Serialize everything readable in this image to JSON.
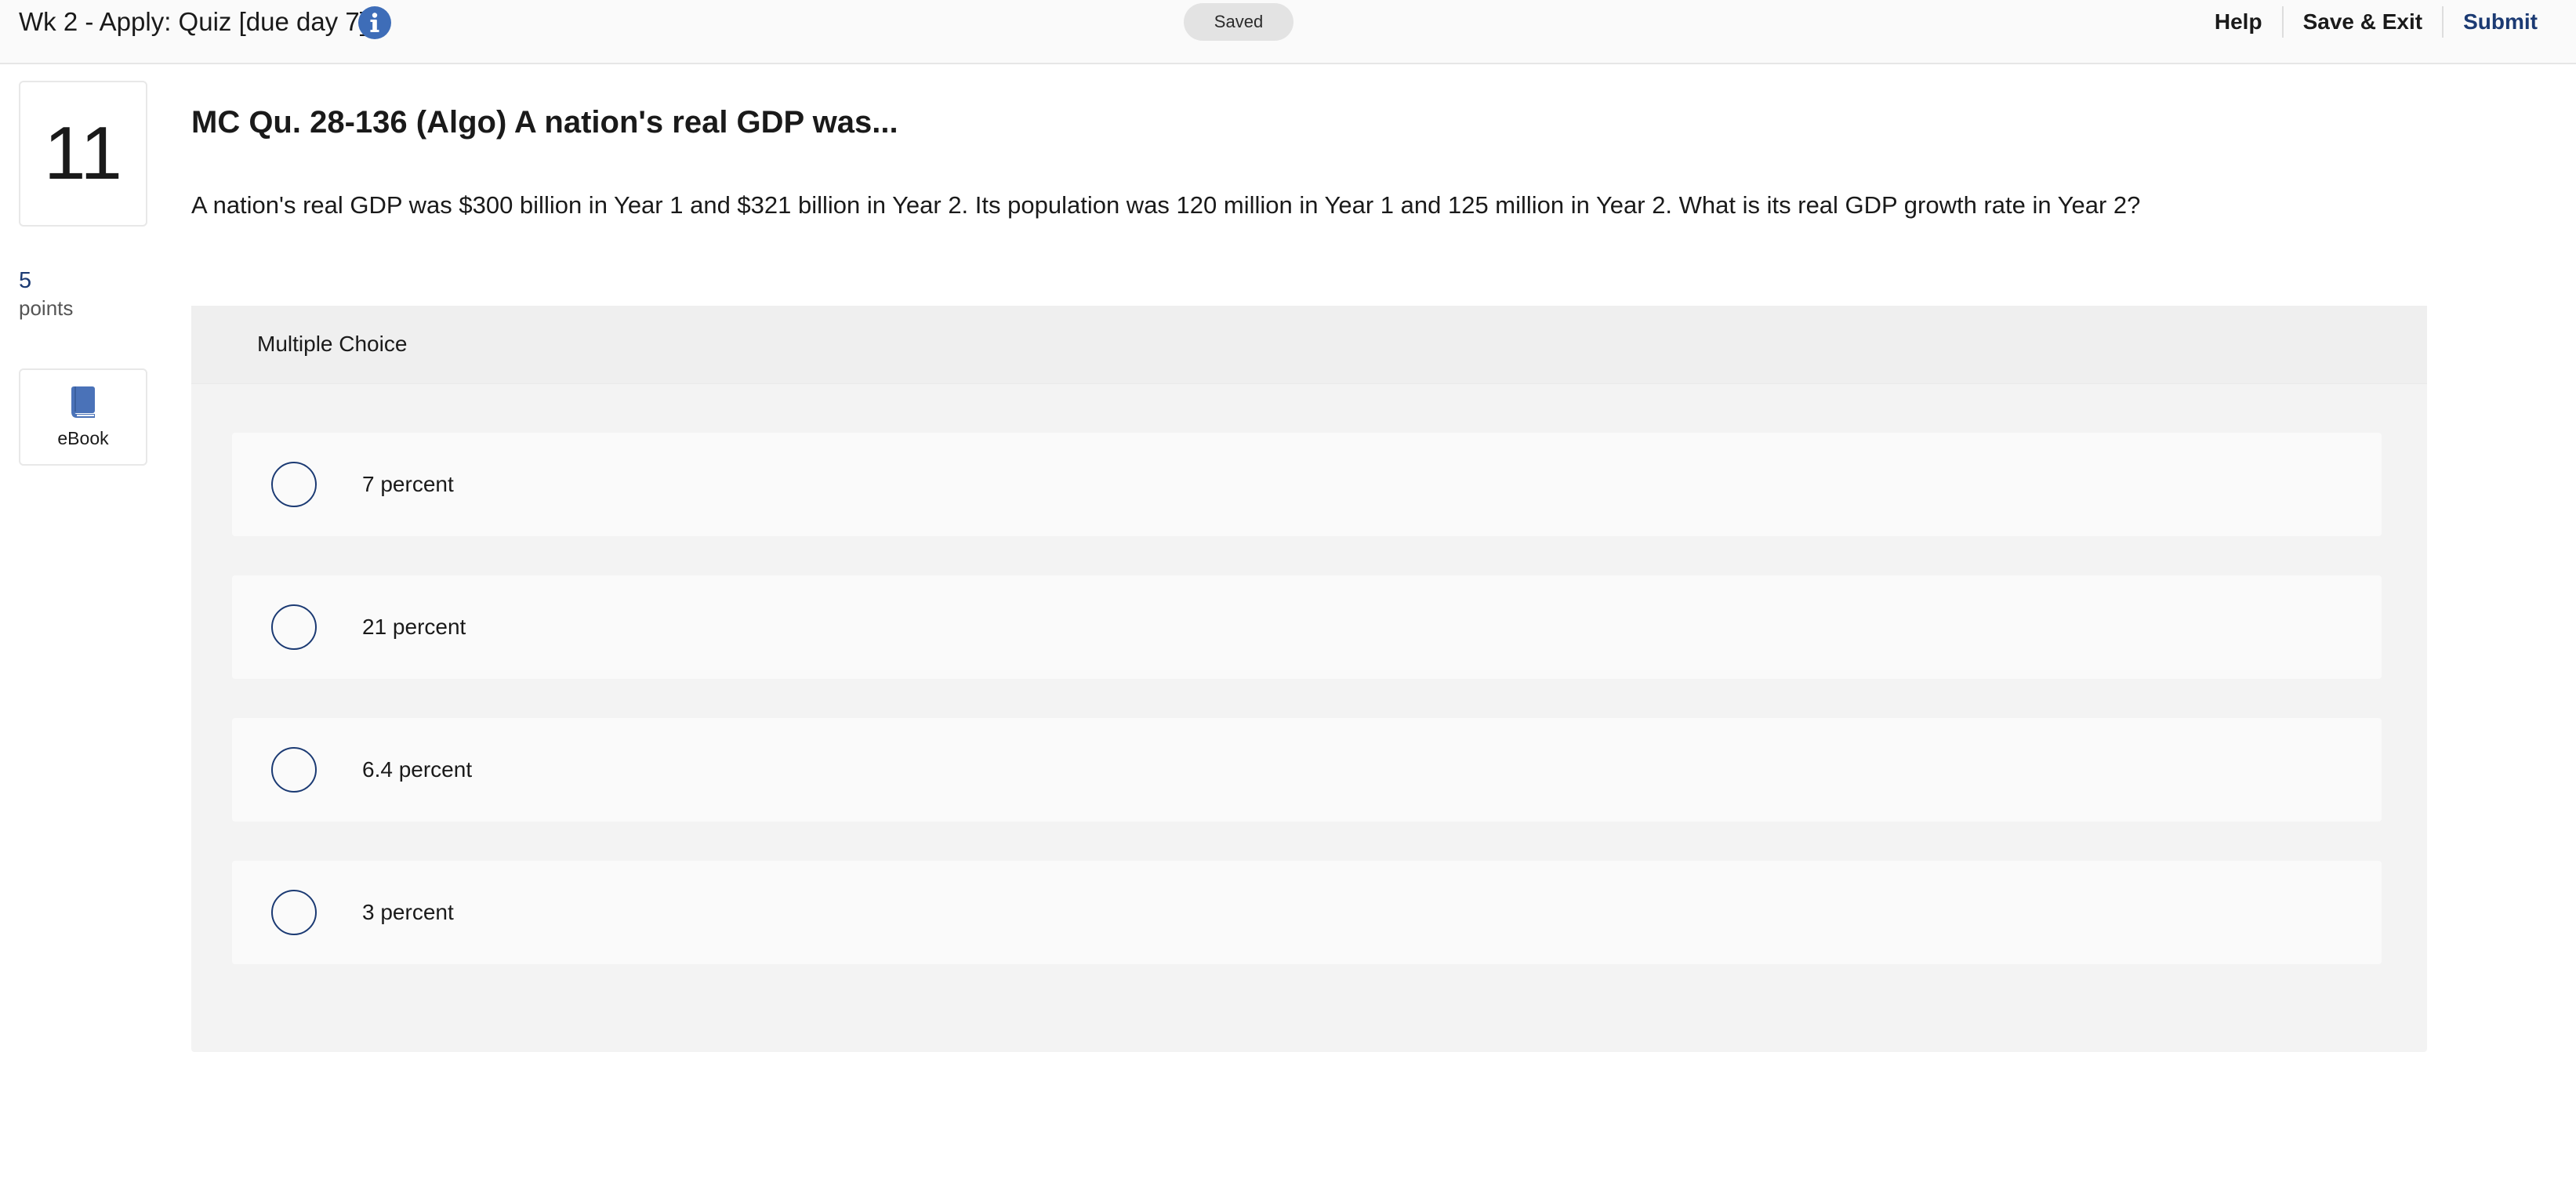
{
  "header": {
    "assignment_title": "Wk 2 - Apply: Quiz [due day 7]",
    "info_icon": "info-icon",
    "saved_status": "Saved",
    "help_label": "Help",
    "save_exit_label": "Save & Exit",
    "submit_label": "Submit"
  },
  "sidebar": {
    "question_number": "11",
    "points_value": "5",
    "points_label": "points",
    "ebook_icon": "book-icon",
    "ebook_label": "eBook"
  },
  "question": {
    "title": "MC Qu. 28-136 (Algo) A nation's real GDP was...",
    "text": "A nation's real GDP was $300 billion in Year 1 and $321 billion in Year 2. Its population was 120 million in Year 1 and 125 million in Year 2. What is its real GDP growth rate in Year 2?",
    "type_label": "Multiple Choice",
    "choices": [
      {
        "label": "7 percent"
      },
      {
        "label": "21 percent"
      },
      {
        "label": "6.4 percent"
      },
      {
        "label": "3 percent"
      }
    ]
  },
  "colors": {
    "accent_navy": "#1b3a73",
    "info_blue": "#3e6db8",
    "book_blue": "#4a72b8",
    "panel_bg": "#f3f3f3"
  }
}
